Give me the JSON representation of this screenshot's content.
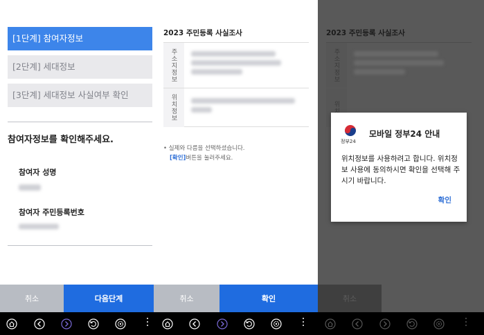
{
  "panel1": {
    "steps": [
      {
        "label": "[1단계] 참여자정보"
      },
      {
        "label": "[2단계] 세대정보"
      },
      {
        "label": "[3단계] 세대정보 사실여부 확인"
      }
    ],
    "heading": "참여자정보를 확인해주세요.",
    "name_label": "참여자 성명",
    "id_label": "참여자 주민등록번호",
    "cancel_label": "취소",
    "next_label": "다음단계"
  },
  "panel2": {
    "title": "2023 주민등록 사실조사",
    "address_head": "주소지정보",
    "location_head": "위치정보",
    "note1": "• 실제와 다름을 선택하셨습니다.",
    "note2_link": "[확인]",
    "note2_text": "버튼을 눌러주세요.",
    "cancel_label": "취소",
    "confirm_label": "확인"
  },
  "panel3": {
    "title": "2023 주민등록 사실조사",
    "address_head": "주소지정보",
    "location_head": "위치",
    "cancel_label": "취소"
  },
  "dialog": {
    "logo_text": "정부24",
    "title": "모바일 정부24 안내",
    "body": "위치정보를 사용하려고 합니다. 위치정보 사용에 동의하시면 확인을 선택해 주시기 바랍니다.",
    "ok_label": "확인"
  },
  "colors": {
    "accent": "#1f6ce0",
    "step_active": "#3d85ea",
    "overlay": "#595959"
  },
  "navbar": {
    "icons": [
      "home-icon",
      "back-icon",
      "forward-icon",
      "refresh-icon",
      "settings-icon",
      "more-icon"
    ]
  }
}
